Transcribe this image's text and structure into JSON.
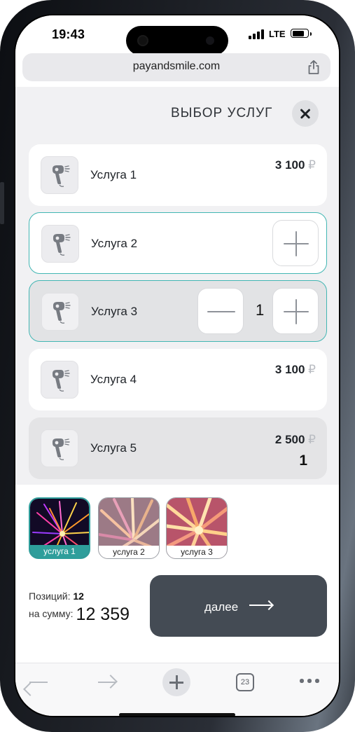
{
  "status_bar": {
    "time": "19:43",
    "network": "LTE"
  },
  "browser": {
    "url": "payandsmile.com",
    "tabs_count": "23"
  },
  "header": {
    "title": "ВЫБОР УСЛУГ"
  },
  "services": [
    {
      "label": "Услуга 1",
      "price": "3 100",
      "currency": "₽"
    },
    {
      "label": "Услуга 2"
    },
    {
      "label": "Услуга 3",
      "quantity": "1"
    },
    {
      "label": "Услуга 4",
      "price": "3 100",
      "currency": "₽"
    },
    {
      "label": "Услуга 5",
      "price": "2 500",
      "currency": "₽",
      "quantity": "1"
    }
  ],
  "stories": [
    {
      "label": "услуга 1",
      "active": true
    },
    {
      "label": "услуга 2",
      "active": false
    },
    {
      "label": "услуга 3",
      "active": false
    }
  ],
  "summary": {
    "positions_label": "Позиций:",
    "positions_value": "12",
    "sum_label": "на сумму:",
    "sum_value": "12 359"
  },
  "next_button": {
    "label": "далее"
  },
  "colors": {
    "accent": "#42b6b3",
    "button_dark": "#444b54",
    "background": "#f1f1f3"
  }
}
